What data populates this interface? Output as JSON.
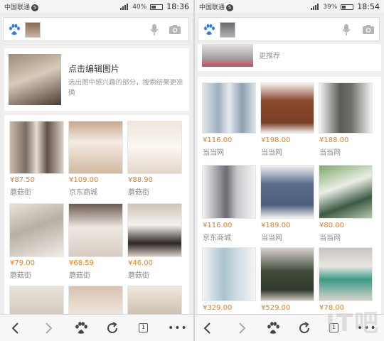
{
  "left": {
    "status": {
      "carrier": "中国联通",
      "carrier_badge": "5",
      "battery": "40%",
      "battery_level": 0.4,
      "time": "18:36"
    },
    "edit": {
      "title": "点击编辑图片",
      "subtitle": "选出图中感兴趣的部分，搜索结果更准确"
    },
    "products": [
      {
        "price": "¥87.50",
        "shop": "蘑菇街"
      },
      {
        "price": "¥109.00",
        "shop": "京东商城"
      },
      {
        "price": "¥88.90",
        "shop": "蘑菇街"
      },
      {
        "price": "¥79.00",
        "shop": "蘑菇街"
      },
      {
        "price": "¥68.59",
        "shop": "蘑菇街"
      },
      {
        "price": "¥46.00",
        "shop": "蘑菇街"
      }
    ]
  },
  "right": {
    "status": {
      "carrier": "中国联通",
      "carrier_badge": "5",
      "battery": "39%",
      "battery_level": 0.39,
      "time": "18:54"
    },
    "top_shop": "更推荐",
    "products": [
      {
        "price": "¥116.00",
        "shop": "当当网"
      },
      {
        "price": "¥198.00",
        "shop": "当当网"
      },
      {
        "price": "¥188.00",
        "shop": "当当网"
      },
      {
        "price": "¥116.00",
        "shop": "京东商城"
      },
      {
        "price": "¥189.00",
        "shop": "当当网"
      },
      {
        "price": "¥80.00",
        "shop": "当当网"
      },
      {
        "price": "¥329.00",
        "shop": ""
      },
      {
        "price": "¥529.00",
        "shop": ""
      },
      {
        "price": "¥78.00",
        "shop": ""
      }
    ]
  },
  "toolbar": {
    "tabs_count": "1",
    "more": "•••"
  },
  "icons": {
    "back": "chevron-left-icon",
    "forward": "chevron-right-icon",
    "home": "baidu-paw-icon",
    "refresh": "refresh-icon",
    "tabs": "tabs-icon",
    "menu": "more-icon",
    "mic": "microphone-icon",
    "camera": "camera-icon"
  },
  "colors": {
    "price": "#f07c1b",
    "brand": "#2f7de1"
  },
  "watermark": "IT吧"
}
